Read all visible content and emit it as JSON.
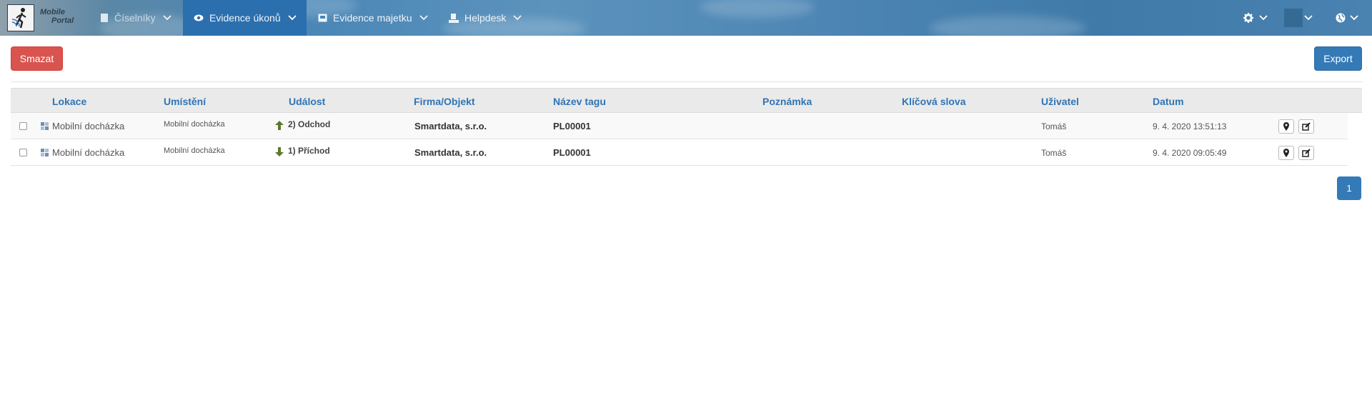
{
  "app": {
    "logo_line1": "Mobile",
    "logo_line2": "Portal"
  },
  "nav": {
    "items": [
      {
        "label": "Číselníky",
        "icon": "document-icon"
      },
      {
        "label": "Evidence úkonů",
        "icon": "eye-icon",
        "active": true
      },
      {
        "label": "Evidence majetku",
        "icon": "inbox-icon"
      },
      {
        "label": "Helpdesk",
        "icon": "helpdesk-icon"
      }
    ],
    "right": [
      "gear-icon",
      "user-icon",
      "globe-icon"
    ]
  },
  "toolbar": {
    "delete_label": "Smazat",
    "export_label": "Export"
  },
  "table": {
    "columns": [
      "Lokace",
      "Umístění",
      "Událost",
      "Firma/Objekt",
      "Název tagu",
      "Poznámka",
      "Klíčová slova",
      "Uživatel",
      "Datum"
    ],
    "rows": [
      {
        "lokace": "Mobilní docházka",
        "umisteni": "Mobilní docházka",
        "udalost": "2) Odchod",
        "direction": "up",
        "firma": "Smartdata, s.r.o.",
        "tag": "PL00001",
        "poznamka": "",
        "klicova_slova": "",
        "uzivatel": "Tomáš",
        "datum": "9. 4. 2020 13:51:13"
      },
      {
        "lokace": "Mobilní docházka",
        "umisteni": "Mobilní docházka",
        "udalost": "1) Příchod",
        "direction": "down",
        "firma": "Smartdata, s.r.o.",
        "tag": "PL00001",
        "poznamka": "",
        "klicova_slova": "",
        "uzivatel": "Tomáš",
        "datum": "9. 4. 2020 09:05:49"
      }
    ]
  },
  "pagination": {
    "current": "1"
  },
  "colors": {
    "accent": "#337ab7",
    "danger": "#d9534f",
    "arrow": "#5a7a2a",
    "header_text": "#2f74b5"
  }
}
